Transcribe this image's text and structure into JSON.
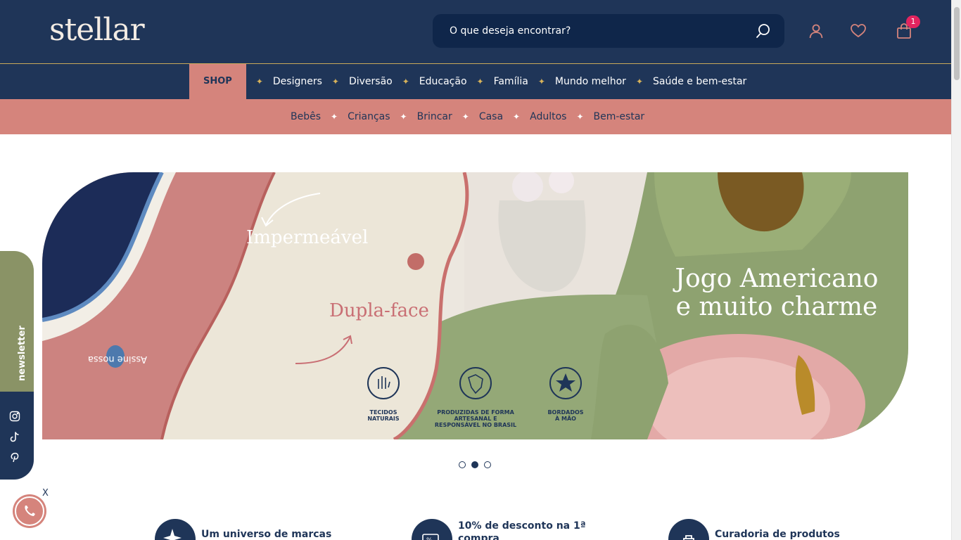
{
  "header": {
    "logo": "stellar",
    "search_placeholder": "O que deseja encontrar?",
    "cart_count": "1"
  },
  "nav_main": {
    "items": [
      "SHOP",
      "Designers",
      "Diversão",
      "Educação",
      "Família",
      "Mundo melhor",
      "Saúde e bem-estar"
    ]
  },
  "nav_sub": {
    "items": [
      "Bebês",
      "Crianças",
      "Brincar",
      "Casa",
      "Adultos",
      "Bem-estar"
    ]
  },
  "banner": {
    "label1": "Impermeável",
    "label2": "Dupla-face",
    "headline_line1": "Jogo Americano",
    "headline_line2": "e muito charme",
    "badges": [
      {
        "line1": "TECIDOS",
        "line2": "NATURAIS",
        "line3": ""
      },
      {
        "line1": "PRODUZIDAS DE FORMA",
        "line2": "ARTESANAL E",
        "line3": "RESPONSÁVEL NO BRASIL"
      },
      {
        "line1": "BORDADOS",
        "line2": "À MÃO",
        "line3": ""
      }
    ],
    "slide_count": 3,
    "active_slide": 2
  },
  "side": {
    "newsletter_prefix": "Assine nossa ",
    "newsletter_bold": "newsletter",
    "social_icons": [
      "instagram-icon",
      "tiktok-icon",
      "pinterest-icon"
    ],
    "whatsapp_close": "X"
  },
  "features": [
    {
      "line1": "Um universo de marcas",
      "line2": ""
    },
    {
      "line1": "10% de desconto na 1ª",
      "line2": "compra"
    },
    {
      "line1": "Curadoria de produtos",
      "line2": ""
    }
  ],
  "colors": {
    "navy": "#1f3558",
    "rose": "#d5847c",
    "olive": "#8a9366",
    "gold": "#d8b35a",
    "badge": "#e3245f"
  }
}
